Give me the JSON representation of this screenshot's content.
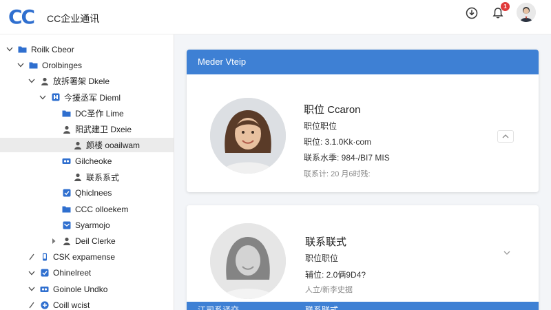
{
  "app": {
    "title": "CC企业通讯",
    "logo_text": "CC",
    "notification_count": "1"
  },
  "sidebar": {
    "items": [
      {
        "label": "Roilk Cbeor",
        "level": 0,
        "chevron": "down",
        "icon": "folder-icon"
      },
      {
        "label": "Orolbinges",
        "level": 1,
        "chevron": "down",
        "icon": "folder-icon"
      },
      {
        "label": "放拆署架 Dkele",
        "level": 2,
        "chevron": "down",
        "icon": "person-icon"
      },
      {
        "label": "今援丞军 Dieml",
        "level": 3,
        "chevron": "down",
        "icon": "org-icon"
      },
      {
        "label": "DC圣作 Lime",
        "level": 4,
        "chevron": "none",
        "icon": "folder-icon"
      },
      {
        "label": "阳武建卫 Dxeie",
        "level": 4,
        "chevron": "none",
        "icon": "person-icon"
      },
      {
        "label": "颜楼 ooailwam",
        "level": 5,
        "chevron": "none",
        "icon": "person-icon"
      },
      {
        "label": "Gilcheoke",
        "level": 4,
        "chevron": "none",
        "icon": "group-icon"
      },
      {
        "label": "联系系式",
        "level": 5,
        "chevron": "none",
        "icon": "person-icon"
      },
      {
        "label": "Qhiclnees",
        "level": 4,
        "chevron": "none",
        "icon": "checkbox-icon"
      },
      {
        "label": "CCC olloekem",
        "level": 4,
        "chevron": "none",
        "icon": "folder-icon"
      },
      {
        "label": "Syarmojo",
        "level": 4,
        "chevron": "none",
        "icon": "inbox-icon"
      },
      {
        "label": "Deil Clerke",
        "level": 4,
        "chevron": "right",
        "icon": "person-icon"
      },
      {
        "label": "CSK expamense",
        "level": 2,
        "chevron": "slash",
        "icon": "phone-icon"
      },
      {
        "label": "Ohinelreet",
        "level": 2,
        "chevron": "down",
        "icon": "checkbox-icon"
      },
      {
        "label": "Goinole Undko",
        "level": 2,
        "chevron": "down",
        "icon": "group-icon"
      },
      {
        "label": "Coill wcist",
        "level": 2,
        "chevron": "slash",
        "icon": "add-circle-icon"
      }
    ],
    "selected_index": 6
  },
  "card1": {
    "header": "Meder Vteip",
    "name": "职位 Ccaron",
    "position": "职位职位",
    "email": "职位: 3.1.0Kk·com",
    "phone": "联系水季: 984-/BI7 MIS",
    "meta": "联系计: 20 月6时残:"
  },
  "card2": {
    "name": "联系联式",
    "position": "职位职位",
    "email": "辅位: 2.0俩9D4?",
    "meta": "人立/新李史据",
    "footer_left": "江司系译交",
    "footer_right": "联系联式"
  },
  "colors": {
    "accent": "#3e80d4",
    "logo": "#2f6fcf",
    "badge": "#e03b3b"
  }
}
